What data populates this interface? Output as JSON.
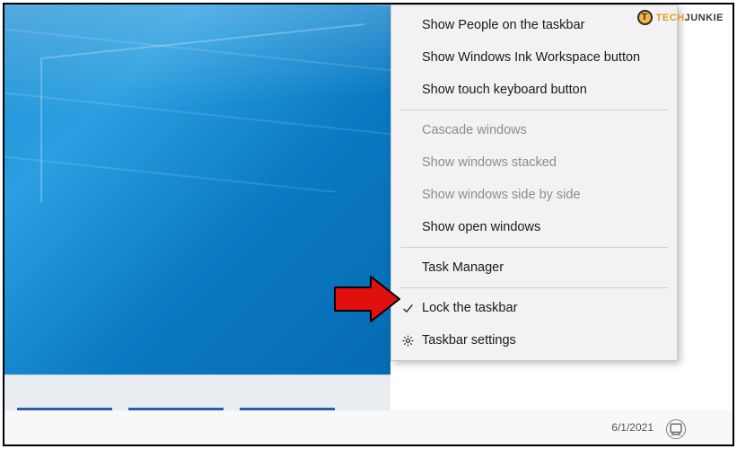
{
  "menu": {
    "show_people": "Show People on the taskbar",
    "show_ink": "Show Windows Ink Workspace button",
    "show_touch_kb": "Show touch keyboard button",
    "cascade": "Cascade windows",
    "stacked": "Show windows stacked",
    "side_by_side": "Show windows side by side",
    "show_open": "Show open windows",
    "task_manager": "Task Manager",
    "lock_taskbar": "Lock the taskbar",
    "taskbar_settings": "Taskbar settings"
  },
  "tray": {
    "date": "6/1/2021"
  },
  "watermark": {
    "brand_a": "TECH",
    "brand_b": "JUNKIE",
    "logo_letter": "T"
  }
}
